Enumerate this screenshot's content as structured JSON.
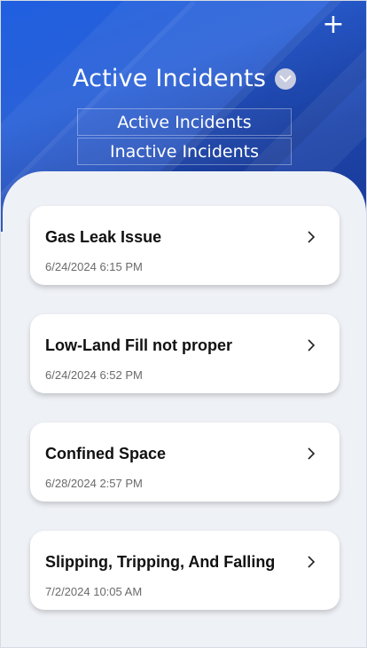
{
  "header": {
    "add_icon": "plus-icon",
    "title": "Active Incidents",
    "dropdown_icon": "chevron-down-icon",
    "dropdown_options": [
      "Active Incidents",
      "Inactive Incidents"
    ]
  },
  "incidents": [
    {
      "title": "Gas Leak Issue",
      "datetime": "6/24/2024 6:15 PM"
    },
    {
      "title": "Low-Land Fill not proper",
      "datetime": "6/24/2024 6:52 PM"
    },
    {
      "title": "Confined Space",
      "datetime": "6/28/2024 2:57 PM"
    },
    {
      "title": "Slipping, Tripping, And Falling",
      "datetime": "7/2/2024 10:05 AM"
    }
  ],
  "colors": {
    "header_blue": "#2a61d8",
    "background": "#eef1f6",
    "card": "#ffffff"
  }
}
